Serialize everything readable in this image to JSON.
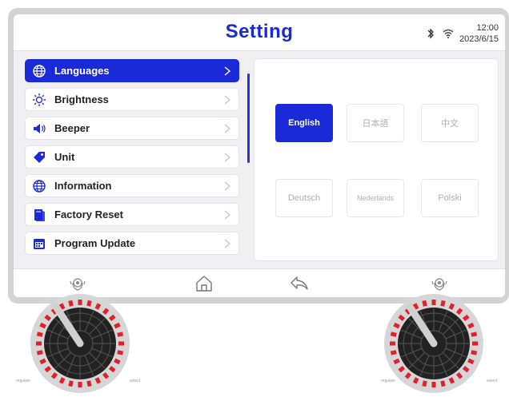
{
  "header": {
    "title": "Setting",
    "time": "12:00",
    "date": "2023/6/15",
    "icons": [
      "bluetooth-icon",
      "wifi-icon"
    ]
  },
  "menu": {
    "items": [
      {
        "label": "Languages",
        "icon": "globe-icon",
        "active": true
      },
      {
        "label": "Brightness",
        "icon": "sun-icon",
        "active": false
      },
      {
        "label": "Beeper",
        "icon": "speaker-icon",
        "active": false
      },
      {
        "label": "Unit",
        "icon": "tag-icon",
        "active": false
      },
      {
        "label": "Information",
        "icon": "globe-icon",
        "active": false
      },
      {
        "label": "Factory Reset",
        "icon": "book-icon",
        "active": false
      },
      {
        "label": "Program Update",
        "icon": "calendar-icon",
        "active": false
      }
    ]
  },
  "languages": {
    "options": [
      "English",
      "日本語",
      "中文",
      "Deutsch",
      "Nederlands",
      "Polski"
    ],
    "selected": "English"
  },
  "navbar": {
    "icons": [
      "left-knob-icon",
      "home-icon",
      "back-icon",
      "right-knob-icon"
    ]
  },
  "knobs": {
    "left": {
      "caption_left": "regulate",
      "caption_right": "select"
    },
    "right": {
      "caption_left": "regulate",
      "caption_right": "select"
    }
  },
  "colors": {
    "accent": "#1a2ad8",
    "title": "#1b2ad0",
    "knob_red": "#e0202a",
    "knob_dark": "#1e1e1e"
  }
}
